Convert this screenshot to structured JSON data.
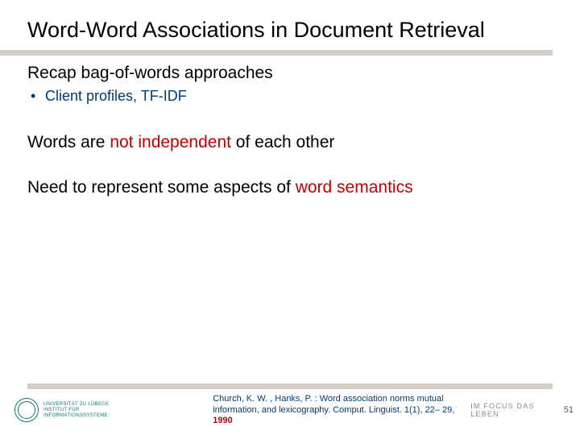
{
  "title": "Word-Word Associations in Document Retrieval",
  "subhead": "Recap bag-of-words approaches",
  "bullet": "Client profiles, TF-IDF",
  "para1_pre": "Words are ",
  "para1_hl": "not independent",
  "para1_post": " of each other",
  "para2_pre": "Need to represent some aspects of ",
  "para2_hl": "word semantics",
  "uni_line1": "UNIVERSITÄT ZU LÜBECK",
  "uni_line2": "INSTITUT FÜR INFORMATIONSSYSTEME",
  "citation_main": "Church, K. W. , Hanks, P. : Word association norms mutual information, and lexicography. Comput. Linguist. 1(1), 22– 29, ",
  "citation_year": "1990",
  "focus_tag": "IM FOCUS DAS LEBEN",
  "page_number": "51"
}
